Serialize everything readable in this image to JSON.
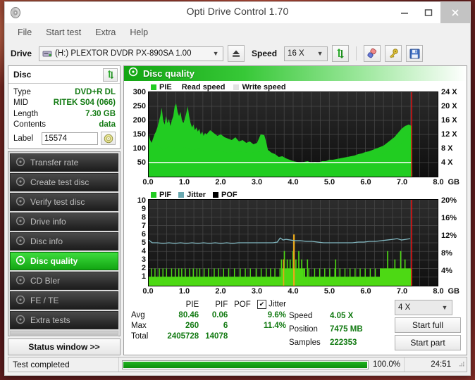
{
  "window": {
    "title": "Opti Drive Control 1.70",
    "icon": "disc-app-icon",
    "minimize": "–",
    "maximize": "☐",
    "close": "✕"
  },
  "menu": {
    "items": [
      "File",
      "Start test",
      "Extra",
      "Help"
    ]
  },
  "toolbar": {
    "drive_label": "Drive",
    "drive_value": "(H:)   PLEXTOR DVDR   PX-890SA 1.00",
    "eject_icon": "eject-icon",
    "speed_label": "Speed",
    "speed_value": "16 X",
    "refresh_icon": "refresh-icon",
    "erase_icon": "eraser-icon",
    "settings_icon": "key-icon",
    "save_icon": "save-floppy-icon"
  },
  "disc_panel": {
    "title": "Disc",
    "refresh_icon": "refresh-icon",
    "rows": [
      {
        "key": "Type",
        "value": "DVD+R DL"
      },
      {
        "key": "MID",
        "value": "RITEK S04 (066)"
      },
      {
        "key": "Length",
        "value": "7.30 GB"
      },
      {
        "key": "Contents",
        "value": "data"
      }
    ],
    "label_key": "Label",
    "label_value": "15574",
    "label_placeholder": "",
    "disc_icon": "cd-disc-icon"
  },
  "nav": {
    "items": [
      {
        "label": "Transfer rate",
        "icon": "disc-icon",
        "active": false
      },
      {
        "label": "Create test disc",
        "icon": "disc-icon",
        "active": false
      },
      {
        "label": "Verify test disc",
        "icon": "disc-icon",
        "active": false
      },
      {
        "label": "Drive info",
        "icon": "disc-icon",
        "active": false
      },
      {
        "label": "Disc info",
        "icon": "disc-icon",
        "active": false
      },
      {
        "label": "Disc quality",
        "icon": "disc-icon",
        "active": true
      },
      {
        "label": "CD Bler",
        "icon": "disc-icon",
        "active": false
      },
      {
        "label": "FE / TE",
        "icon": "disc-icon",
        "active": false
      },
      {
        "label": "Extra tests",
        "icon": "disc-icon",
        "active": false
      }
    ],
    "status_window": "Status window >>"
  },
  "panel": {
    "header_title": "Disc quality",
    "header_icon": "disc-quality-icon"
  },
  "stats": {
    "columns": [
      "PIE",
      "PIF",
      "POF",
      "Jitter"
    ],
    "jitter_checked": true,
    "jitter_label": "Jitter",
    "rows": [
      {
        "name": "Avg",
        "pie": "80.46",
        "pif": "0.06",
        "pof": "",
        "jitter": "9.6%"
      },
      {
        "name": "Max",
        "pie": "260",
        "pif": "6",
        "pof": "",
        "jitter": "11.4%"
      },
      {
        "name": "Total",
        "pie": "2405728",
        "pif": "14078",
        "pof": "",
        "jitter": ""
      }
    ],
    "info": [
      {
        "key": "Speed",
        "value": "4.05 X"
      },
      {
        "key": "Position",
        "value": "7475 MB"
      },
      {
        "key": "Samples",
        "value": "222353"
      }
    ],
    "write_speed": "4 X",
    "start_full": "Start full",
    "start_part": "Start part"
  },
  "statusbar": {
    "text": "Test completed",
    "percent": "100.0%",
    "progress": 100,
    "time": "24:51",
    "grip_icon": "resize-grip-icon"
  },
  "colors": {
    "accent_green": "#12a512",
    "value_green": "#127a12",
    "pie_green": "#22cc22",
    "jitter_teal": "#6aa8b0",
    "marker_red": "#ee1111",
    "plot_bg": "#1b1b1b",
    "write_speed_gray": "#dcdcdc"
  },
  "chart_data": [
    {
      "type": "area",
      "id": "pie-chart",
      "title": "PIE / Read speed",
      "legend": [
        {
          "label": "PIE",
          "color": "#22cc22",
          "swatch": true
        },
        {
          "label": "Read speed",
          "color": "#ffffff",
          "swatch": false
        },
        {
          "label": "Write speed",
          "color": "#dcdcdc",
          "swatch": true
        }
      ],
      "xlabel": "GB",
      "xticks": [
        "0.0",
        "1.0",
        "2.0",
        "3.0",
        "4.0",
        "5.0",
        "6.0",
        "7.0",
        "8.0"
      ],
      "xlim": [
        0,
        8
      ],
      "ylabel": "PIE",
      "yticks": [
        50,
        100,
        150,
        200,
        250,
        300
      ],
      "ylim": [
        0,
        300
      ],
      "y2label": "X",
      "y2ticks": [
        "4 X",
        "8 X",
        "12 X",
        "16 X",
        "20 X",
        "24 X"
      ],
      "y2lim": [
        0,
        24
      ],
      "grid": true,
      "data_end_gb": 7.3,
      "marker_gb": 7.3,
      "read_speed_value": 4.05,
      "series": [
        {
          "name": "PIE",
          "color": "#22cc22",
          "x": [
            0.0,
            0.05,
            0.1,
            0.15,
            0.2,
            0.25,
            0.3,
            0.35,
            0.4,
            0.45,
            0.5,
            0.55,
            0.6,
            0.65,
            0.7,
            0.75,
            0.8,
            0.85,
            0.9,
            0.95,
            1.0,
            1.05,
            1.1,
            1.15,
            1.2,
            1.25,
            1.3,
            1.35,
            1.4,
            1.45,
            1.5,
            1.55,
            1.6,
            1.65,
            1.7,
            1.75,
            1.8,
            1.85,
            1.9,
            1.95,
            2.0,
            2.1,
            2.2,
            2.3,
            2.4,
            2.5,
            2.6,
            2.7,
            2.8,
            2.9,
            3.0,
            3.1,
            3.2,
            3.3,
            3.4,
            3.5,
            3.6,
            3.65,
            3.7,
            3.8,
            3.9,
            4.0,
            4.1,
            4.2,
            4.3,
            4.4,
            4.5,
            4.6,
            4.7,
            4.8,
            4.9,
            5.0,
            5.1,
            5.2,
            5.3,
            5.4,
            5.5,
            5.6,
            5.7,
            5.8,
            5.9,
            6.0,
            6.1,
            6.2,
            6.3,
            6.4,
            6.5,
            6.6,
            6.7,
            6.8,
            6.9,
            7.0,
            7.1,
            7.2,
            7.28,
            7.3
          ],
          "values": [
            150,
            120,
            110,
            135,
            150,
            160,
            175,
            195,
            215,
            245,
            200,
            185,
            215,
            190,
            205,
            180,
            200,
            215,
            250,
            260,
            230,
            215,
            230,
            200,
            190,
            205,
            225,
            250,
            215,
            190,
            175,
            185,
            165,
            175,
            160,
            170,
            150,
            160,
            145,
            155,
            150,
            165,
            155,
            145,
            150,
            140,
            135,
            130,
            140,
            125,
            130,
            120,
            125,
            115,
            120,
            150,
            148,
            120,
            95,
            85,
            80,
            70,
            72,
            66,
            58,
            55,
            52,
            50,
            48,
            52,
            50,
            48,
            52,
            50,
            55,
            52,
            50,
            58,
            60,
            62,
            65,
            68,
            72,
            75,
            80,
            82,
            88,
            92,
            100,
            110,
            120,
            130,
            145,
            160,
            175,
            168
          ]
        },
        {
          "name": "Read speed",
          "color": "#ffffff",
          "x": [
            0.0,
            3.5,
            3.55,
            7.3
          ],
          "values_x": [
            4.05,
            4.05,
            4.05,
            4.05
          ]
        }
      ]
    },
    {
      "type": "bar",
      "id": "pif-chart",
      "title": "PIF / Jitter / POF",
      "legend": [
        {
          "label": "PIF",
          "color": "#22cc22",
          "swatch": true
        },
        {
          "label": "Jitter",
          "color": "#6aa8b0",
          "swatch": true
        },
        {
          "label": "POF",
          "color": "#000000",
          "swatch": true
        }
      ],
      "xlabel": "GB",
      "xticks": [
        "0.0",
        "1.0",
        "2.0",
        "3.0",
        "4.0",
        "5.0",
        "6.0",
        "7.0",
        "8.0"
      ],
      "xlim": [
        0,
        8
      ],
      "ylabel": "PIF",
      "yticks": [
        1,
        2,
        3,
        4,
        5,
        6,
        7,
        8,
        9,
        10
      ],
      "ylim": [
        0,
        10
      ],
      "y2label": "%",
      "y2ticks": [
        "4%",
        "8%",
        "12%",
        "16%",
        "20%"
      ],
      "y2lim": [
        0,
        20
      ],
      "grid": true,
      "data_end_gb": 7.3,
      "marker_gb": 7.3,
      "jitter_avg_pct": 9.6,
      "jitter_max_pct": 11.4,
      "series": [
        {
          "name": "Jitter",
          "color": "#6aa8b0",
          "x": [
            0.0,
            0.2,
            0.4,
            0.6,
            0.8,
            1.0,
            1.2,
            1.4,
            1.6,
            1.8,
            2.0,
            2.2,
            2.4,
            2.6,
            2.8,
            3.0,
            3.2,
            3.4,
            3.55,
            3.62,
            3.68,
            3.75,
            3.85,
            4.0,
            4.2,
            4.4,
            4.6,
            4.8,
            5.0,
            5.2,
            5.4,
            5.6,
            5.8,
            6.0,
            6.2,
            6.4,
            6.6,
            6.8,
            7.0,
            7.15,
            7.28
          ],
          "values_pct": [
            10.2,
            9.4,
            9.3,
            9.4,
            9.3,
            9.4,
            9.3,
            9.4,
            9.3,
            9.3,
            9.4,
            9.3,
            9.4,
            9.4,
            9.4,
            9.5,
            9.5,
            9.4,
            9.4,
            11.3,
            10.6,
            10.4,
            10.3,
            10.2,
            10.1,
            10.0,
            9.9,
            9.8,
            9.7,
            9.7,
            9.8,
            9.8,
            9.9,
            9.9,
            10.0,
            10.1,
            10.3,
            10.5,
            10.6,
            10.4,
            10.5
          ]
        },
        {
          "name": "PIF",
          "color": "#22cc22",
          "note": "dense spikes mostly 1-2, cluster of 3-4 near 3.6-4.2 GB and 6.7-7.2 GB"
        }
      ]
    }
  ]
}
